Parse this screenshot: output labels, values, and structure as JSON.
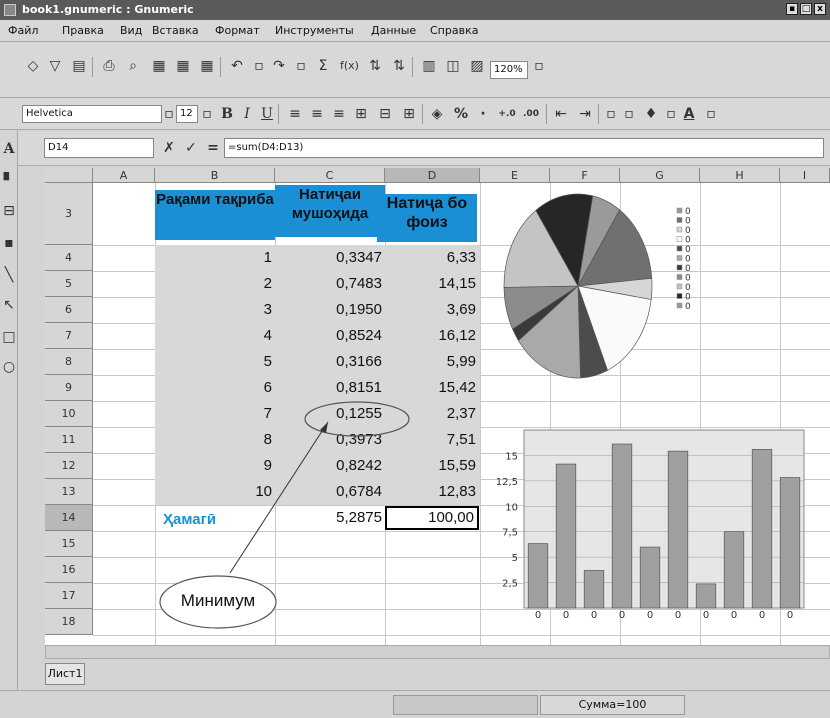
{
  "window": {
    "title": "book1.gnumeric : Gnumeric",
    "buttons": [
      "▪",
      "□",
      "x"
    ]
  },
  "menu": [
    "Файл",
    "Правка",
    "Вид",
    "Вставка",
    "Формат",
    "Инструменты",
    "Данные",
    "Справка"
  ],
  "toolbar1": {
    "zoom": "120%"
  },
  "toolbar2": {
    "font": "Helvetica",
    "size": "12",
    "bold": "B",
    "italic": "I",
    "underline": "U",
    "percent": "%",
    "dot": "·",
    "inc_dec": "+.0",
    "dec_dec": ".00"
  },
  "formula": {
    "cell_ref": "D14",
    "text": "=sum(D4:D13)",
    "cancel": "✗",
    "accept": "✓",
    "equals": "="
  },
  "columns": [
    "A",
    "B",
    "C",
    "D",
    "E",
    "F",
    "G",
    "H",
    "I"
  ],
  "rows": [
    "3",
    "4",
    "5",
    "6",
    "7",
    "8",
    "9",
    "10",
    "11",
    "12",
    "13",
    "14",
    "15",
    "16",
    "17",
    "18"
  ],
  "headers": {
    "b3": "Рақами тақриба",
    "c3": "Натиҷаи мушоҳида",
    "d3": "Натиҷа бо фоиз"
  },
  "table": [
    {
      "b": "1",
      "c": "0,3347",
      "d": "6,33"
    },
    {
      "b": "2",
      "c": "0,7483",
      "d": "14,15"
    },
    {
      "b": "3",
      "c": "0,1950",
      "d": "3,69"
    },
    {
      "b": "4",
      "c": "0,8524",
      "d": "16,12"
    },
    {
      "b": "5",
      "c": "0,3166",
      "d": "5,99"
    },
    {
      "b": "6",
      "c": "0,8151",
      "d": "15,42"
    },
    {
      "b": "7",
      "c": "0,1255",
      "d": "2,37"
    },
    {
      "b": "8",
      "c": "0,3973",
      "d": "7,51"
    },
    {
      "b": "9",
      "c": "0,8242",
      "d": "15,59"
    },
    {
      "b": "10",
      "c": "0,6784",
      "d": "12,83"
    }
  ],
  "total": {
    "label": "Ҳамагӣ",
    "c": "5,2875",
    "d": "100,00"
  },
  "annotation": "Минимум",
  "sheet_tab": "Лист1",
  "status": "Сумма=100",
  "colors": {
    "header_bg": "#1a8fd6",
    "total_label": "#1a8fd6",
    "selection": "#d8d8d8"
  },
  "chart_data": [
    {
      "type": "pie",
      "values": [
        6.33,
        14.15,
        3.69,
        16.12,
        5.99,
        15.42,
        2.37,
        7.51,
        15.59,
        12.83
      ],
      "legend": [
        "0",
        "0",
        "0",
        "0",
        "0",
        "0",
        "0",
        "0",
        "0",
        "0",
        "0"
      ]
    },
    {
      "type": "bar",
      "categories": [
        "0",
        "0",
        "0",
        "0",
        "0",
        "0",
        "0",
        "0",
        "0",
        "0"
      ],
      "values": [
        6.33,
        14.15,
        3.69,
        16.12,
        5.99,
        15.42,
        2.37,
        7.51,
        15.59,
        12.83
      ],
      "yticks": [
        "15",
        "12,5",
        "10",
        "7,5",
        "5",
        "2,5"
      ],
      "ylim": [
        0,
        17.5
      ],
      "grid": true
    }
  ]
}
